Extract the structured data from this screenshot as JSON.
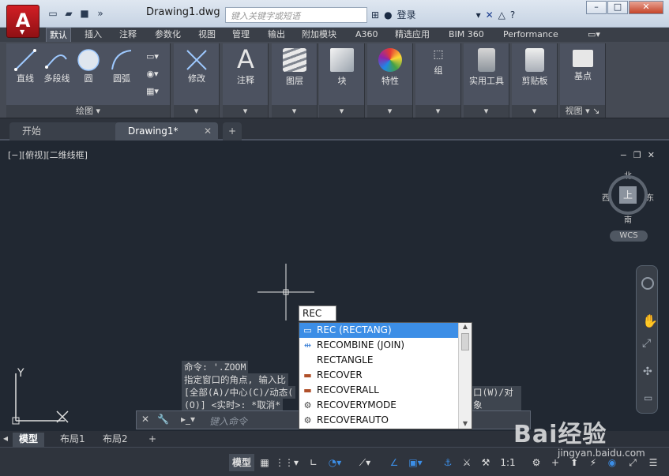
{
  "window": {
    "title": "Drawing1.dwg",
    "search_placeholder": "键入关键字或短语",
    "login_label": "登录",
    "help_label": "?"
  },
  "ribbon": {
    "tabs": [
      "默认",
      "插入",
      "注释",
      "参数化",
      "视图",
      "管理",
      "输出",
      "附加模块",
      "A360",
      "精选应用",
      "BIM 360",
      "Performance"
    ],
    "draw_panel": {
      "title": "绘图",
      "tools": [
        "直线",
        "多段线",
        "圆",
        "圆弧"
      ]
    },
    "panels": [
      "修改",
      "注释",
      "图层",
      "块",
      "特性",
      "组",
      "实用工具",
      "剪贴板",
      "基点"
    ],
    "view_label": "视图"
  },
  "file_tabs": [
    "开始",
    "Drawing1*"
  ],
  "viewport": {
    "label": "[−][俯视][二维线框]",
    "compass": {
      "north": "北",
      "south": "南",
      "east": "东",
      "west": "西",
      "top": "上"
    },
    "wcs": "WCS",
    "ucs_y": "Y"
  },
  "command": {
    "history": [
      "命令: '.ZOOM",
      "指定窗口的角点, 输入比",
      "[全部(A)/中心(C)/动态(",
      "(O)] <实时>: *取消*"
    ],
    "history_right": "口(W)/对象",
    "placeholder": "键入命令",
    "typed": "REC"
  },
  "autocomplete": {
    "items": [
      "REC (RECTANG)",
      "RECOMBINE (JOIN)",
      "RECTANGLE",
      "RECOVER",
      "RECOVERALL",
      "RECOVERYMODE",
      "RECOVERAUTO"
    ],
    "selected_index": 0
  },
  "layout_tabs": [
    "模型",
    "布局1",
    "布局2"
  ],
  "statusbar": {
    "model_label": "模型",
    "scale": "1:1"
  },
  "watermark": {
    "brand": "Bai经验",
    "url": "jingyan.baidu.com"
  },
  "colors": {
    "accent": "#3c8ee6",
    "logo": "#c8191f",
    "canvas": "#212832"
  }
}
